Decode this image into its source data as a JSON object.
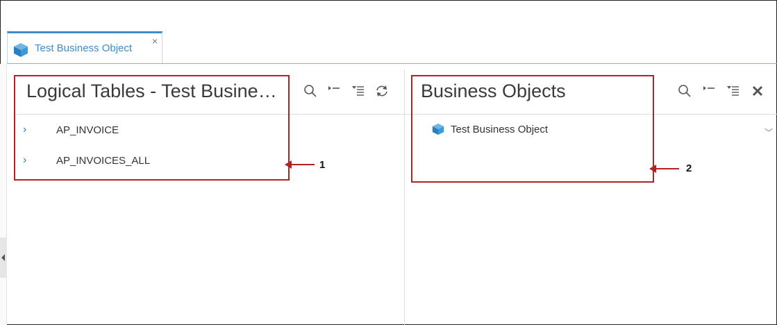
{
  "tab": {
    "title": "Test Business Object",
    "close": "×"
  },
  "left_panel": {
    "title": "Logical Tables - Test Busine…",
    "items": [
      {
        "label": "AP_INVOICE"
      },
      {
        "label": "AP_INVOICES_ALL"
      }
    ]
  },
  "right_panel": {
    "title": "Business Objects",
    "items": [
      {
        "label": "Test Business Object"
      }
    ]
  },
  "callouts": {
    "one": "1",
    "two": "2"
  },
  "icons": {
    "tab": "cube-icon",
    "left_tools": [
      "search-icon",
      "collapse-all-icon",
      "expand-all-icon",
      "refresh-icon"
    ],
    "right_tools": [
      "search-icon",
      "collapse-all-icon",
      "expand-all-icon",
      "close-icon"
    ]
  },
  "colors": {
    "accent": "#3d8ccc",
    "callout": "#b22222"
  }
}
